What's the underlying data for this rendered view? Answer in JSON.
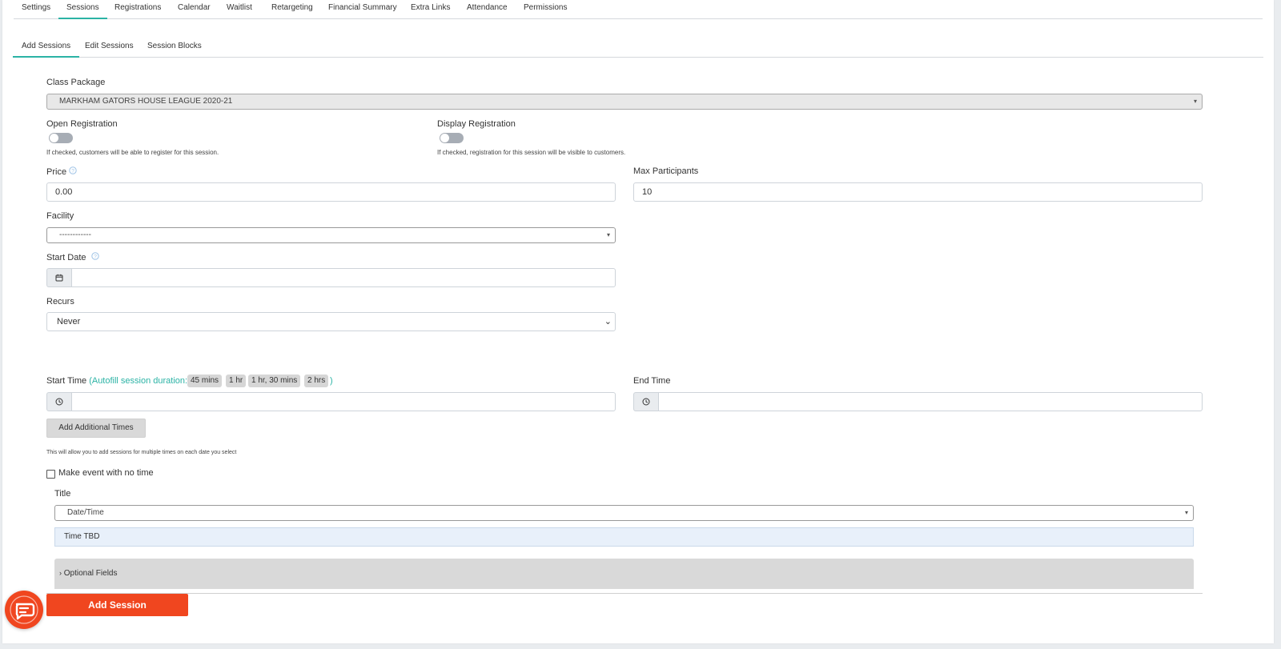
{
  "main_tabs": [
    "Settings",
    "Sessions",
    "Registrations",
    "Calendar",
    "Waitlist",
    "Retargeting",
    "Financial Summary",
    "Extra Links",
    "Attendance",
    "Permissions"
  ],
  "sub_tabs": [
    "Add Sessions",
    "Edit Sessions",
    "Session Blocks"
  ],
  "form": {
    "class_package_label": "Class Package",
    "class_package_value": "MARKHAM GATORS HOUSE LEAGUE 2020-21",
    "open_registration_label": "Open Registration",
    "open_registration_hint": "If checked, customers will be able to register for this session.",
    "display_registration_label": "Display Registration",
    "display_registration_hint": "If checked, registration for this session will be visible to customers.",
    "price_label": "Price",
    "price_value": "0.00",
    "max_participants_label": "Max Participants",
    "max_participants_value": "10",
    "facility_label": "Facility",
    "facility_value": "------------",
    "start_date_label": "Start Date",
    "recurs_label": "Recurs",
    "recurs_value": "Never",
    "start_time_label": "Start Time",
    "autofill_prefix": "(Autofill session duration:",
    "autofill_suffix": ")",
    "autofill_options": [
      "45 mins",
      "1 hr",
      "1 hr, 30 mins",
      "2 hrs"
    ],
    "end_time_label": "End Time",
    "add_additional_times": "Add Additional Times",
    "additional_times_hint": "This will allow you to add sessions for multiple times on each date you select",
    "no_time_label": "Make event with no time",
    "title_label": "Title",
    "title_value": "Date/Time",
    "time_tbd": "Time TBD",
    "optional_fields": "Optional Fields",
    "submit": "Add Session"
  },
  "colors": {
    "accent": "#2bb3a5",
    "primary_button": "#f0461f"
  },
  "icons": {
    "help": "question-circle-icon",
    "calendar": "calendar-icon",
    "clock": "clock-icon",
    "chat": "chat-icon"
  }
}
